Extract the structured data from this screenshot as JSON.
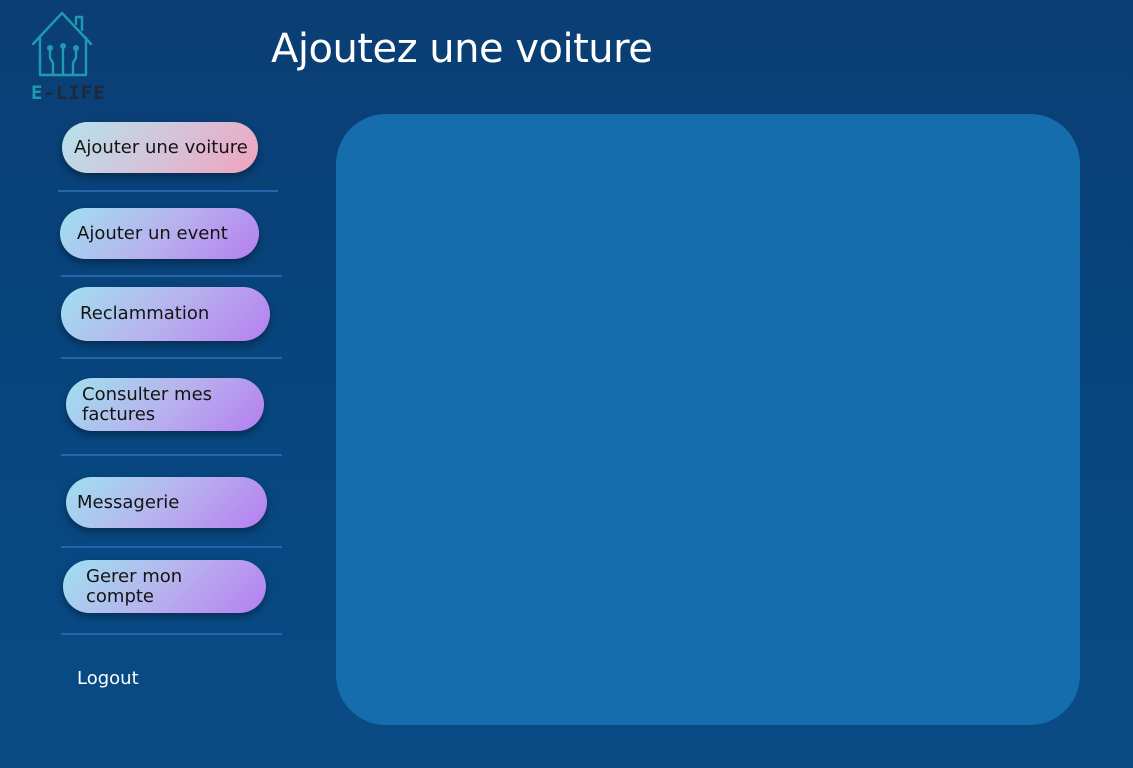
{
  "brand": {
    "logo_text_prefix": "E",
    "logo_text_rest": "-LIFE",
    "logo_icon": "smart-home-icon"
  },
  "header": {
    "title": "Ajoutez une voiture"
  },
  "sidebar": {
    "items": [
      {
        "label": "Ajouter une voiture",
        "active": true
      },
      {
        "label": "Ajouter un event",
        "active": false
      },
      {
        "label": "Reclammation",
        "active": false
      },
      {
        "label": "Consulter mes factures",
        "active": false
      },
      {
        "label": "Messagerie",
        "active": false
      },
      {
        "label": "Gerer mon compte",
        "active": false
      }
    ],
    "logout_label": "Logout"
  },
  "colors": {
    "background": "#07467f",
    "panel": "#166dae",
    "button_gradient_start": "#9fe0ef",
    "button_gradient_end": "#b67ef0",
    "active_button_gradient_end": "#f0a3bc",
    "separator": "#2a68b0"
  }
}
